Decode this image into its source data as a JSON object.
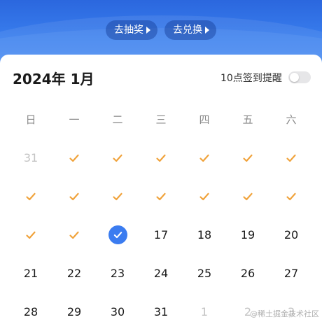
{
  "header": {
    "lottery_label": "去抽奖",
    "exchange_label": "去兑换"
  },
  "calendar": {
    "month_title": "2024年 1月",
    "reminder_label": "10点签到提醒",
    "reminder_on": false,
    "weekdays": [
      "日",
      "一",
      "二",
      "三",
      "四",
      "五",
      "六"
    ],
    "days": [
      {
        "label": "31",
        "state": "muted"
      },
      {
        "label": "",
        "state": "checked"
      },
      {
        "label": "",
        "state": "checked"
      },
      {
        "label": "",
        "state": "checked"
      },
      {
        "label": "",
        "state": "checked"
      },
      {
        "label": "",
        "state": "checked"
      },
      {
        "label": "",
        "state": "checked"
      },
      {
        "label": "",
        "state": "checked"
      },
      {
        "label": "",
        "state": "checked"
      },
      {
        "label": "",
        "state": "checked"
      },
      {
        "label": "",
        "state": "checked"
      },
      {
        "label": "",
        "state": "checked"
      },
      {
        "label": "",
        "state": "checked"
      },
      {
        "label": "",
        "state": "checked"
      },
      {
        "label": "",
        "state": "checked"
      },
      {
        "label": "",
        "state": "checked"
      },
      {
        "label": "",
        "state": "today"
      },
      {
        "label": "17",
        "state": "normal"
      },
      {
        "label": "18",
        "state": "normal"
      },
      {
        "label": "19",
        "state": "normal"
      },
      {
        "label": "20",
        "state": "normal"
      },
      {
        "label": "21",
        "state": "normal"
      },
      {
        "label": "22",
        "state": "normal"
      },
      {
        "label": "23",
        "state": "normal"
      },
      {
        "label": "24",
        "state": "normal"
      },
      {
        "label": "25",
        "state": "normal"
      },
      {
        "label": "26",
        "state": "normal"
      },
      {
        "label": "27",
        "state": "normal"
      },
      {
        "label": "28",
        "state": "normal"
      },
      {
        "label": "29",
        "state": "normal"
      },
      {
        "label": "30",
        "state": "normal"
      },
      {
        "label": "31",
        "state": "normal"
      },
      {
        "label": "1",
        "state": "muted"
      },
      {
        "label": "2",
        "state": "muted"
      },
      {
        "label": "3",
        "state": "muted"
      }
    ]
  },
  "colors": {
    "accent": "#3b7cf0",
    "check": "#f0a23a"
  },
  "watermark": "@稀土掘金技术社区"
}
